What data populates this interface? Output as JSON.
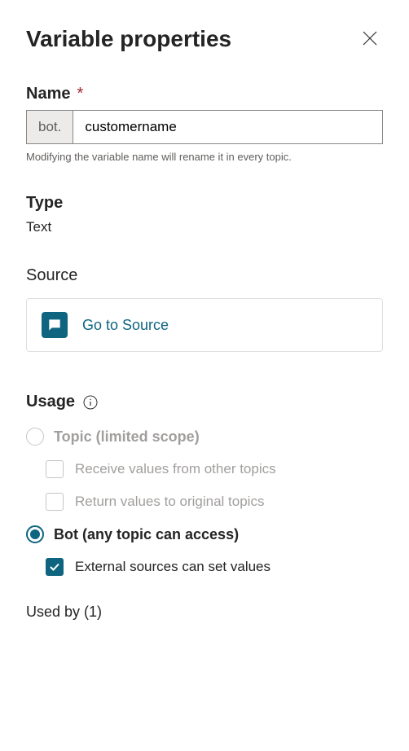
{
  "header": {
    "title": "Variable properties"
  },
  "name": {
    "label": "Name",
    "required_marker": "*",
    "prefix": "bot.",
    "value": "customername",
    "helper": "Modifying the variable name will rename it in every topic."
  },
  "type": {
    "label": "Type",
    "value": "Text"
  },
  "source": {
    "label": "Source",
    "link_text": "Go to Source"
  },
  "usage": {
    "label": "Usage",
    "options": {
      "topic": {
        "label": "Topic (limited scope)",
        "selected": false,
        "receive": "Receive values from other topics",
        "return": "Return values to original topics"
      },
      "bot": {
        "label": "Bot (any topic can access)",
        "selected": true,
        "external": "External sources can set values",
        "external_checked": true
      }
    }
  },
  "used_by": {
    "label": "Used by (1)"
  }
}
